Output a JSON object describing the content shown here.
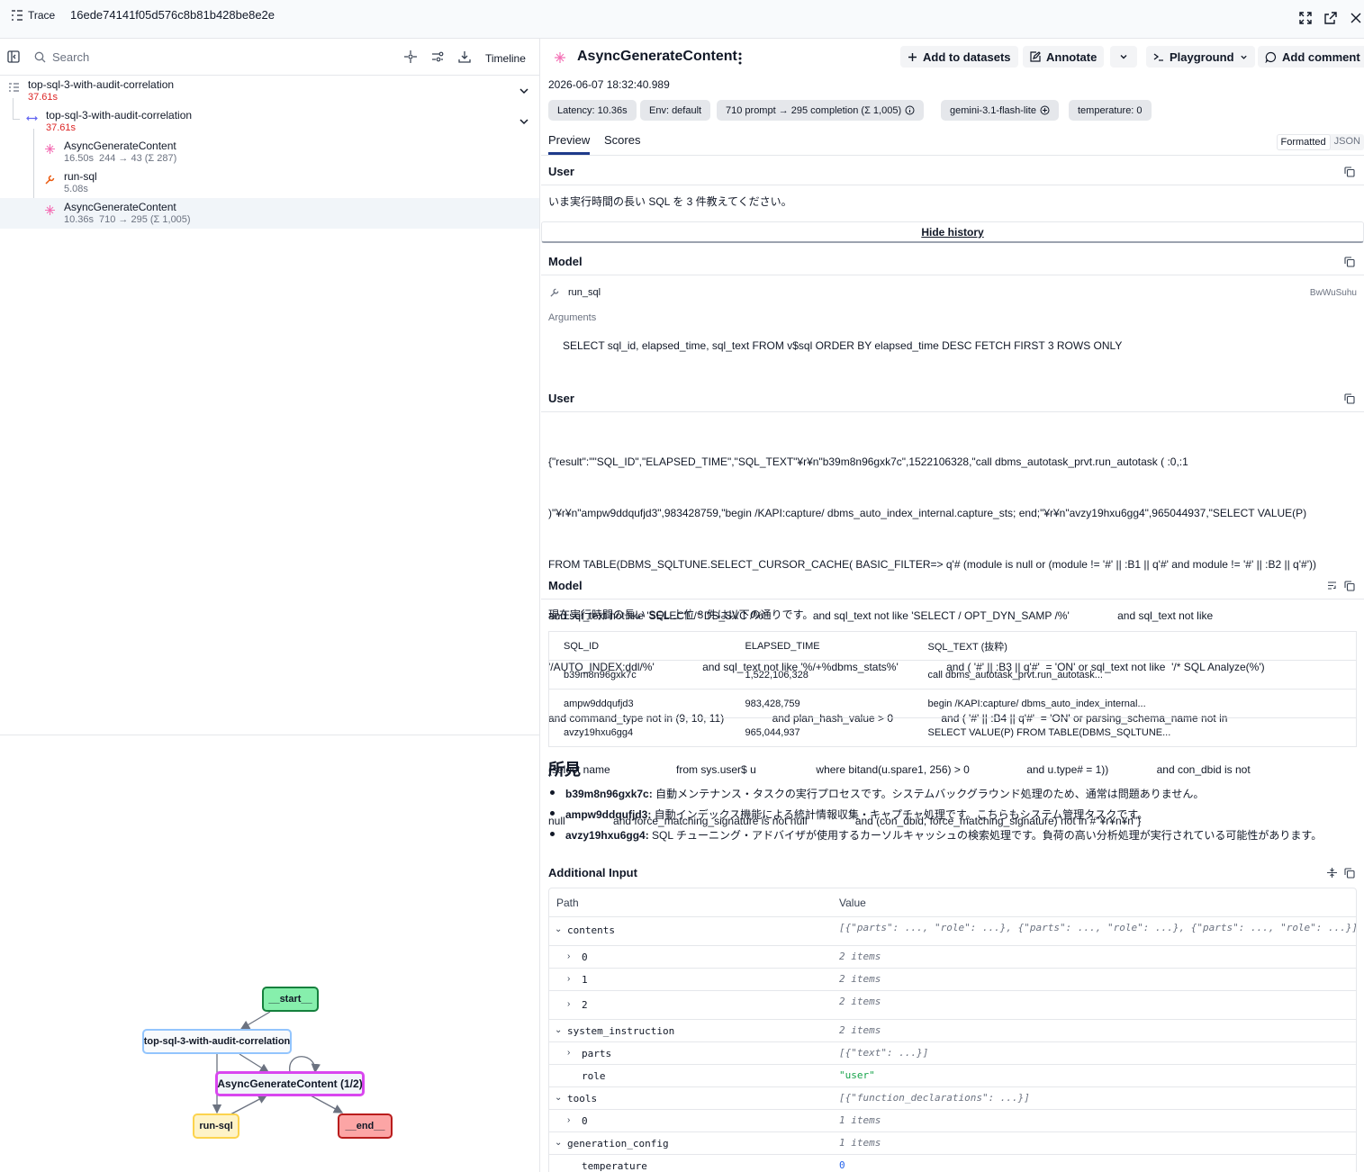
{
  "topbar": {
    "trace_label": "Trace",
    "trace_id": "16ede74141f05d576c8b81b428be8e2e"
  },
  "left": {
    "search_placeholder": "Search",
    "timeline_label": "Timeline",
    "tree": [
      {
        "name": "top-sql-3-with-audit-correlation",
        "meta": "37.61s"
      },
      {
        "name": "top-sql-3-with-audit-correlation",
        "meta": "37.61s"
      },
      {
        "name": "AsyncGenerateContent",
        "duration": "16.50s",
        "tokens": "244 → 43 (Σ 287)"
      },
      {
        "name": "run-sql",
        "duration": "5.08s"
      },
      {
        "name": "AsyncGenerateContent",
        "duration": "10.36s",
        "tokens": "710 → 295 (Σ 1,005)"
      }
    ],
    "graph": {
      "start": "__start__",
      "chain": "top-sql-3-with-audit-correlation",
      "agc": "AsyncGenerateContent (1/2)",
      "runsql": "run-sql",
      "end": "__end__"
    }
  },
  "right": {
    "title": "AsyncGenerateContent",
    "actions": {
      "add_to_datasets": "Add to datasets",
      "annotate": "Annotate",
      "playground": "Playground",
      "add_comment": "Add comment"
    },
    "timestamp": "2026-06-07 18:32:40.989",
    "badges": {
      "latency": "Latency: 10.36s",
      "env": "Env: default",
      "tokens": "710 prompt → 295 completion (Σ 1,005)",
      "model": "gemini-3.1-flash-lite",
      "temperature": "temperature: 0"
    },
    "tabs": {
      "preview": "Preview",
      "scores": "Scores"
    },
    "format": {
      "formatted": "Formatted",
      "json": "JSON"
    },
    "user1": {
      "label": "User",
      "text": "いま実行時間の長い SQL を 3 件教えてください。"
    },
    "hide_history": "Hide history",
    "model1": {
      "label": "Model",
      "tool_name": "run_sql",
      "tool_id": "BwWuSuhu",
      "arguments_label": "Arguments",
      "arguments": "SELECT sql_id, elapsed_time, sql_text FROM v$sql ORDER BY elapsed_time DESC FETCH FIRST 3 ROWS ONLY"
    },
    "user2": {
      "label": "User",
      "lines": [
        "{\"result\":\"\"SQL_ID\",\"ELAPSED_TIME\",\"SQL_TEXT\"¥r¥n\"b39m8n96gxk7c\",1522106328,\"call dbms_autotask_prvt.run_autotask ( :0,:1",
        ")\"¥r¥n\"ampw9ddqufjd3\",983428759,\"begin /KAPI:capture/ dbms_auto_index_internal.capture_sts; end;\"¥r¥n\"avzy19hxu6gg4\",965044937,\"SELECT VALUE(P)",
        "FROM TABLE(DBMS_SQLTUNE.SELECT_CURSOR_CACHE( BASIC_FILTER=> q'# (module is null or (module != '#' || :B1 || q'#' and module != '#' || :B2 || q'#'))",
        "and sql_text not like 'SELECT /* DS_SVC /%'                and sql_text not like 'SELECT / OPT_DYN_SAMP /%'                and sql_text not like",
        "'/AUTO_INDEX:ddl/%'                and sql_text not like '%/+%dbms_stats%'                and ( '#' || :B3 || q'#'  = 'ON' or sql_text not like  '/* SQL Analyze(%')",
        "and command_type not in (9, 10, 11)                and plan_hash_value > 0                and ( '#' || :B4 || q'#'  = 'ON' or parsing_schema_name not in",
        "(select name                      from sys.user$ u                    where bitand(u.spare1, 256) > 0                   and u.type# = 1))                and con_dbid is not",
        "null                and force_matching_signature is not null                and (con_dbid, force_matching_signature) not in #\"¥r¥n¥n\"}"
      ]
    },
    "model2": {
      "label": "Model",
      "intro": "現在実行時間の長い SQL 上位 3 件は以下の通りです。",
      "columns": [
        "SQL_ID",
        "ELAPSED_TIME",
        "SQL_TEXT (抜粋)"
      ],
      "rows": [
        [
          "b39m8n96gxk7c",
          "1,522,106,328",
          "call dbms_autotask_prvt.run_autotask..."
        ],
        [
          "ampw9ddqufjd3",
          "983,428,759",
          "begin /KAPI:capture/ dbms_auto_index_internal..."
        ],
        [
          "avzy19hxu6gg4",
          "965,044,937",
          "SELECT VALUE(P) FROM TABLE(DBMS_SQLTUNE..."
        ]
      ],
      "findings_title": "所見",
      "findings": [
        {
          "id": "b39m8n96gxk7c:",
          "text": " 自動メンテナンス・タスクの実行プロセスです。システムバックグラウンド処理のため、通常は問題ありません。"
        },
        {
          "id": "ampw9ddqufjd3:",
          "text": " 自動インデックス機能による統計情報収集・キャプチャ処理です。こちらもシステム管理タスクです。"
        },
        {
          "id": "avzy19hxu6gg4:",
          "text": " SQL チューニング・アドバイザが使用するカーソルキャッシュの検索処理です。負荷の高い分析処理が実行されている可能性があります。"
        }
      ]
    },
    "additional_input": {
      "label": "Additional Input",
      "col_path": "Path",
      "col_value": "Value",
      "rows": [
        {
          "path": "contents",
          "value": "[{\"parts\": ..., \"role\": ...}, {\"parts\": ..., \"role\": ...}, {\"parts\": ..., \"role\": ...}]"
        },
        {
          "path": "0",
          "value": "2 items"
        },
        {
          "path": "1",
          "value": "2 items"
        },
        {
          "path": "2",
          "value": "2 items"
        },
        {
          "path": "system_instruction",
          "value": "2 items"
        },
        {
          "path": "parts",
          "value": "[{\"text\": ...}]"
        },
        {
          "path": "role",
          "value": "\"user\""
        },
        {
          "path": "tools",
          "value": "[{\"function_declarations\": ...}]"
        },
        {
          "path": "0",
          "value": "1 items"
        },
        {
          "path": "generation_config",
          "value": "1 items"
        },
        {
          "path": "temperature",
          "value": "0"
        }
      ]
    }
  }
}
